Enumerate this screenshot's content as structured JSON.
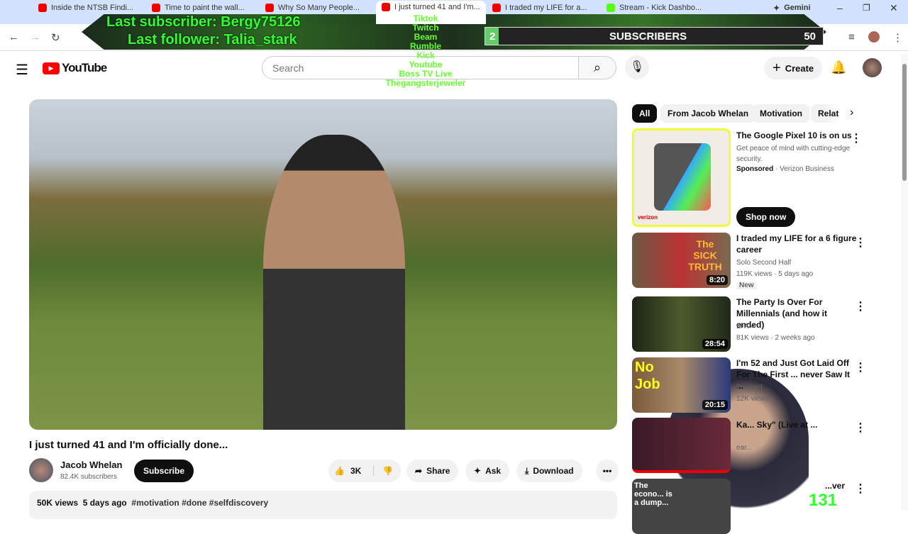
{
  "browser": {
    "tabs": [
      "Inside the NTSB Findi...",
      "Time to paint the wall...",
      "Why So Many People...",
      "I just turned 41 and I'm...",
      "I traded my LIFE for a...",
      "Stream - Kick Dashbo...",
      "Gemini"
    ]
  },
  "overlay": {
    "last_subscriber": "Last subscriber: Bergy75126",
    "last_follower": "Last follower: Talia_stark",
    "platforms": [
      "Tiktok",
      "Twitch",
      "Beam",
      "Rumble",
      "Kick",
      "Youtube",
      "Boss TV Live",
      "Thegangsterjeweler"
    ],
    "sub_goal_label": "SUBSCRIBERS",
    "sub_current": "2",
    "sub_target": "50",
    "sub_progress": 0.04,
    "viewer_count": "131"
  },
  "header": {
    "logo": "YouTube",
    "search_placeholder": "Search",
    "create_label": "Create"
  },
  "video": {
    "title": "I just turned 41 and I'm officially done...",
    "channel": "Jacob Whelan",
    "subscribers": "82.4K subscribers",
    "subscribe_label": "Subscribe",
    "likes": "3K",
    "share_label": "Share",
    "ask_label": "Ask",
    "download_label": "Download",
    "views": "50K views",
    "age": "5 days ago",
    "hashtags": "#motivation #done #selfdiscovery"
  },
  "chips": [
    "All",
    "From Jacob Whelan",
    "Motivation",
    "Relat"
  ],
  "ad": {
    "title": "The Google Pixel 10 is on us",
    "desc": "Get peace of mind with cutting-edge security.",
    "sponsored": "Sponsored",
    "advertiser": "Verizon Business",
    "cta": "Shop now",
    "brand": "verizon"
  },
  "recs": [
    {
      "title": "I traded my LIFE for a 6 figure career",
      "channel": "Solo Second Half",
      "meta": "119K views · 5 days ago",
      "badge": "New",
      "duration": "8:20",
      "thumb_text": "The SICK TRUTH"
    },
    {
      "title": "The Party Is Over For Millennials (and how it ended)",
      "channel": "LFA",
      "meta": "81K views · 2 weeks ago",
      "duration": "28:54"
    },
    {
      "title": "I'm 52 and Just Got Laid Off For The First ... never Saw It ...",
      "channel": "Forward",
      "meta": "12K views",
      "duration": "20:15",
      "thumb_text": "No Job"
    },
    {
      "title": "Ka... Sky\" (Live at ...",
      "channel": "ear..."
    },
    {
      "title": "...ver",
      "thumb_text": "The econo... is a dump..."
    }
  ]
}
